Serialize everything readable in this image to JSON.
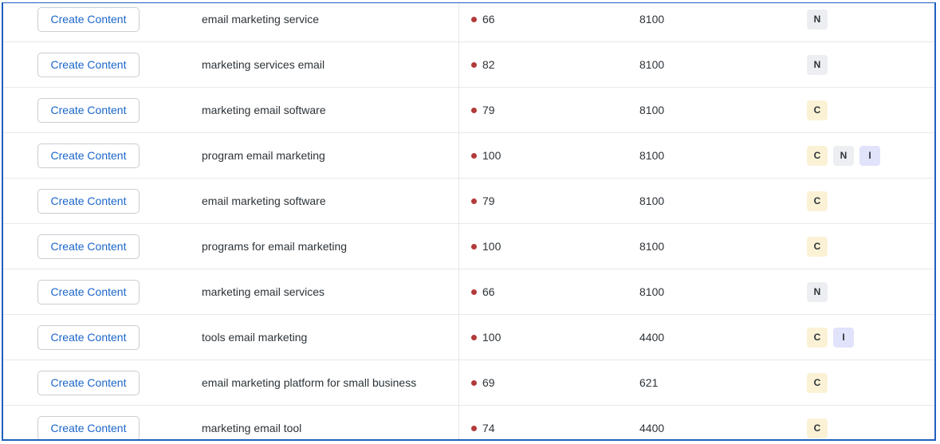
{
  "rows": [
    {
      "action_label": "Create Content",
      "keyword": "email marketing service",
      "kd": "66",
      "volume": "8100",
      "intents": [
        "N"
      ]
    },
    {
      "action_label": "Create Content",
      "keyword": "marketing services email",
      "kd": "82",
      "volume": "8100",
      "intents": [
        "N"
      ]
    },
    {
      "action_label": "Create Content",
      "keyword": "marketing email software",
      "kd": "79",
      "volume": "8100",
      "intents": [
        "C"
      ]
    },
    {
      "action_label": "Create Content",
      "keyword": "program email marketing",
      "kd": "100",
      "volume": "8100",
      "intents": [
        "C",
        "N",
        "I"
      ]
    },
    {
      "action_label": "Create Content",
      "keyword": "email marketing software",
      "kd": "79",
      "volume": "8100",
      "intents": [
        "C"
      ]
    },
    {
      "action_label": "Create Content",
      "keyword": "programs for email marketing",
      "kd": "100",
      "volume": "8100",
      "intents": [
        "C"
      ]
    },
    {
      "action_label": "Create Content",
      "keyword": "marketing email services",
      "kd": "66",
      "volume": "8100",
      "intents": [
        "N"
      ]
    },
    {
      "action_label": "Create Content",
      "keyword": "tools email marketing",
      "kd": "100",
      "volume": "4400",
      "intents": [
        "C",
        "I"
      ]
    },
    {
      "action_label": "Create Content",
      "keyword": "email marketing platform for small business",
      "kd": "69",
      "volume": "621",
      "intents": [
        "C"
      ]
    },
    {
      "action_label": "Create Content",
      "keyword": "marketing email tool",
      "kd": "74",
      "volume": "4400",
      "intents": [
        "C"
      ]
    }
  ],
  "colors": {
    "accent": "#1b66c9",
    "frame_border": "#1f5fbf",
    "kd_dot": "#b23a3a",
    "intent_commercial": "#fbf2d6",
    "intent_navigational": "#eceef1",
    "intent_informational": "#e1e3fb"
  }
}
